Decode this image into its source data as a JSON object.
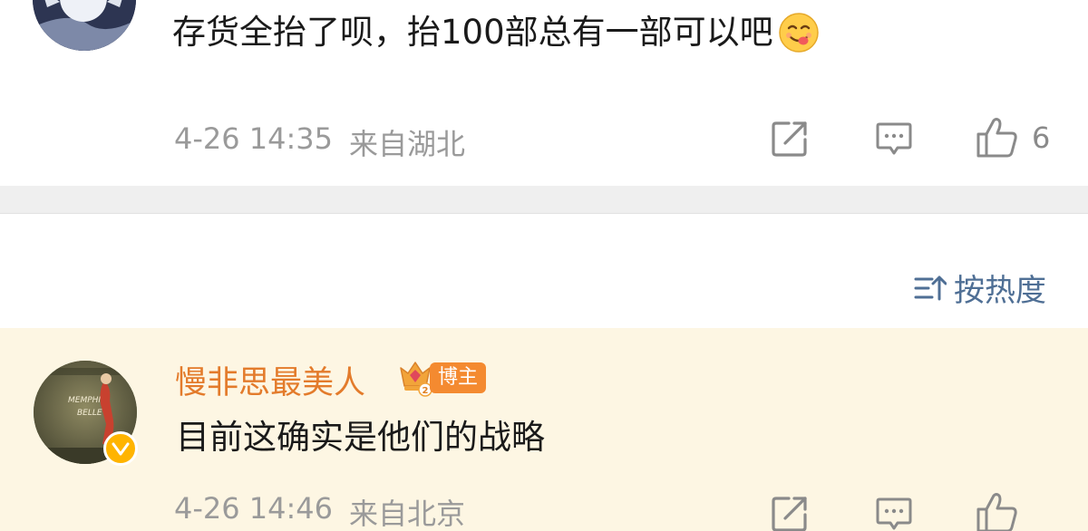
{
  "comments": [
    {
      "text": "存货全抬了呗，抬100部总有一部可以吧",
      "emoji": "yum-face-emoji",
      "date": "4-26 14:35",
      "location": "来自湖北",
      "likes": "6",
      "icons": {
        "share": "share-icon",
        "reply": "comment-icon",
        "like": "thumbs-up-icon"
      }
    },
    {
      "username": "慢非思最美人",
      "badge_level": "2",
      "badge_label": "博主",
      "text": "目前这确实是他们的战略",
      "avatar_text": [
        "MEMPHIS",
        "BELLE"
      ],
      "date": "4-26 14:46",
      "location": "来自北京",
      "highlight_color": "#fdf6e3",
      "name_color": "#e37b2b"
    }
  ],
  "sort": {
    "label": "按热度",
    "icon": "sort-icon",
    "color": "#4f6f95"
  }
}
